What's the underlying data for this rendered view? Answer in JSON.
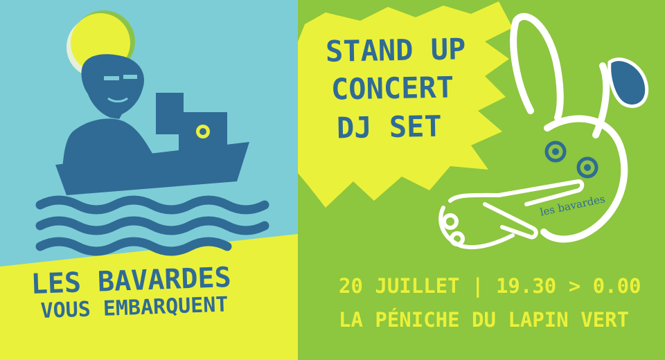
{
  "headline": {
    "line1": "LES BAVARDES",
    "line2": "VOUS EMBARQUENT"
  },
  "acts": [
    "STAND UP",
    "CONCERT",
    "DJ SET"
  ],
  "event": {
    "date_time": "20 JUILLET | 19.30 > 0.00",
    "venue": "LA PÉNICHE DU LAPIN VERT"
  },
  "logo_text": "les bavardes",
  "colors": {
    "sky_blue": "#7dcdd6",
    "lime_green": "#8dc63f",
    "yellow": "#eaf13a",
    "navy_blue": "#2f6b95"
  },
  "icons": [
    "sun-icon",
    "woman-portrait-illustration",
    "boat-icon",
    "waves-icon",
    "rabbit-logo-icon",
    "pointing-hand-icon",
    "starburst-shape"
  ]
}
